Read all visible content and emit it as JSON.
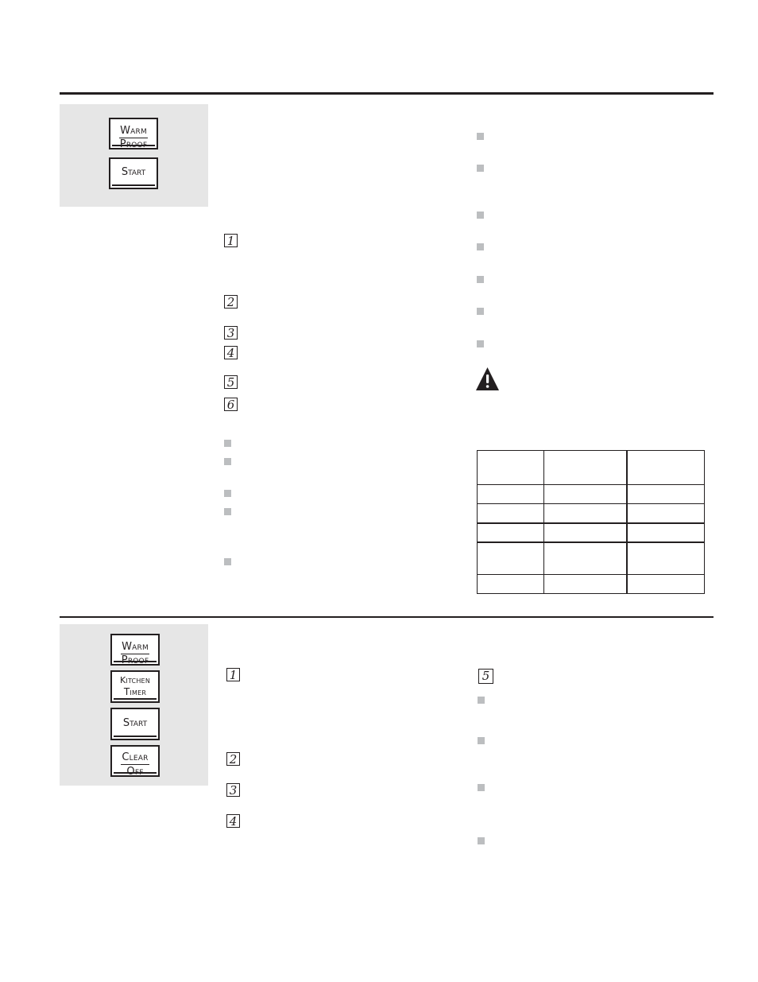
{
  "section1": {
    "keypad": [
      {
        "line1": "Warm",
        "line2": "Proof"
      },
      {
        "label": "Start"
      }
    ],
    "steps": [
      "1",
      "2",
      "3",
      "4",
      "5",
      "6"
    ],
    "warning_icon": "warning-triangle-icon",
    "table": {
      "rows": [
        [
          "",
          "",
          ""
        ],
        [
          "",
          "",
          ""
        ],
        [
          "",
          "",
          ""
        ],
        [
          "",
          "",
          ""
        ],
        [
          "",
          "",
          ""
        ],
        [
          "",
          "",
          ""
        ]
      ]
    }
  },
  "section2": {
    "keypad": [
      {
        "line1": "Warm",
        "line2": "Proof"
      },
      {
        "line1": "Kitchen",
        "line2": "Timer"
      },
      {
        "label": "Start"
      },
      {
        "line1": "Clear",
        "line2": "Off"
      }
    ],
    "steps": [
      "1",
      "2",
      "3",
      "4",
      "5"
    ]
  },
  "colors": {
    "rule": "#231f20",
    "panel": "#e6e6e6",
    "bullet": "#bcbec0"
  }
}
